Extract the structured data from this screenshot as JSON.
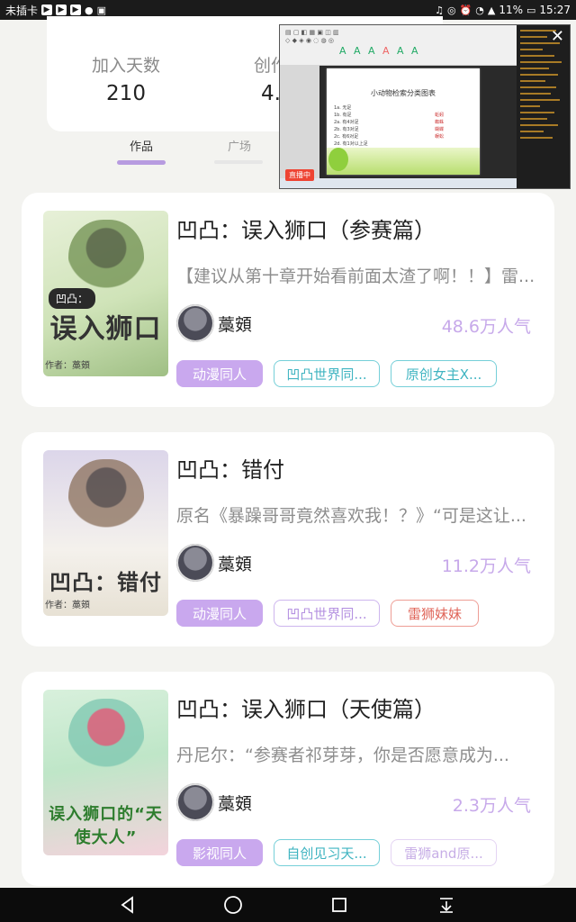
{
  "status_bar": {
    "carrier": "未插卡",
    "battery": "11%",
    "time": "15:27"
  },
  "profile": {
    "stats": [
      {
        "label": "加入天数",
        "value": "210"
      },
      {
        "label": "创作",
        "value": "4."
      }
    ]
  },
  "tabs": [
    {
      "label": "作品",
      "active": true
    },
    {
      "label": "广场",
      "active": false
    }
  ],
  "overlay": {
    "live_badge": "直播中",
    "doc_title": "小动物检索分类图表",
    "doc_rows": [
      "1a. 无足",
      "1b. 有足",
      "2a. 有4对足",
      "2b. 有3对足",
      "2c. 有6对足",
      "2d. 有1对以上足"
    ],
    "doc_answers": [
      "蚯蚓",
      "蜘蛛",
      "蝴蝶",
      "蜈蚣"
    ],
    "close_icon": "close-icon"
  },
  "works": [
    {
      "title": "凹凸：误入狮口（参赛篇）",
      "description": "【建议从第十章开始看前面太渣了啊！！】雷...",
      "author": "藁頞",
      "popularity": "48.6万人气",
      "cover_text": "误入狮口",
      "cover_badge": "凹凸：",
      "cover_author": "作者：藁頞",
      "cover_colors": [
        "#cfe3b8",
        "#5a7a3a"
      ],
      "tags": [
        {
          "label": "动漫同人",
          "style": "solid"
        },
        {
          "label": "凹凸世界同...",
          "style": "cyan"
        },
        {
          "label": "原创女主X...",
          "style": "cyan"
        }
      ]
    },
    {
      "title": "凹凸：错付",
      "description": "原名《暴躁哥哥竟然喜欢我！？》“可是这让...",
      "author": "藁頞",
      "popularity": "11.2万人气",
      "cover_text": "凹凸：错付",
      "cover_badge": "",
      "cover_author": "作者：藁頞",
      "cover_colors": [
        "#e9e4f2",
        "#6d5a4a"
      ],
      "tags": [
        {
          "label": "动漫同人",
          "style": "solid"
        },
        {
          "label": "凹凸世界同...",
          "style": "lav"
        },
        {
          "label": "雷狮妹妹",
          "style": "red"
        }
      ]
    },
    {
      "title": "凹凸：误入狮口（天使篇）",
      "description": "丹尼尔：“参赛者祁芽芽，你是否愿意成为...",
      "author": "藁頞",
      "popularity": "2.3万人气",
      "cover_text": "误入狮口的“天使大人”",
      "cover_badge": "",
      "cover_author": "",
      "cover_colors": [
        "#bfe6c8",
        "#d6476a"
      ],
      "tags": [
        {
          "label": "影视同人",
          "style": "solid"
        },
        {
          "label": "自创见习天...",
          "style": "cyan"
        },
        {
          "label": "雷狮and原...",
          "style": "lav2"
        }
      ]
    }
  ],
  "nav": {
    "back_icon": "back-icon",
    "home_icon": "home-icon",
    "recents_icon": "recents-icon",
    "notifications_icon": "notification-pulldown-icon"
  }
}
